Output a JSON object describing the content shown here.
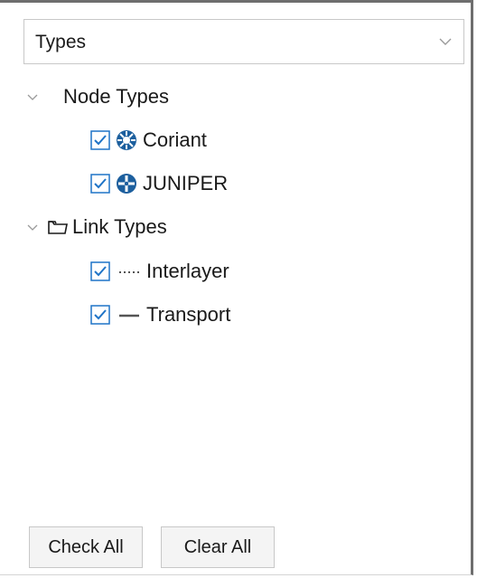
{
  "selector": {
    "value": "Types"
  },
  "tree": {
    "node_types": {
      "label": "Node Types",
      "items": [
        {
          "label": "Coriant",
          "checked": true,
          "icon": "coriant-node-icon"
        },
        {
          "label": "JUNIPER",
          "checked": true,
          "icon": "juniper-node-icon"
        }
      ]
    },
    "link_types": {
      "label": "Link Types",
      "items": [
        {
          "label": "Interlayer",
          "checked": true,
          "icon": "dotted-line-icon"
        },
        {
          "label": "Transport",
          "checked": true,
          "icon": "solid-line-icon"
        }
      ]
    }
  },
  "buttons": {
    "check_all": "Check All",
    "clear_all": "Clear All"
  },
  "colors": {
    "accent": "#1f74c7",
    "node_icon": "#1c5f9e"
  }
}
